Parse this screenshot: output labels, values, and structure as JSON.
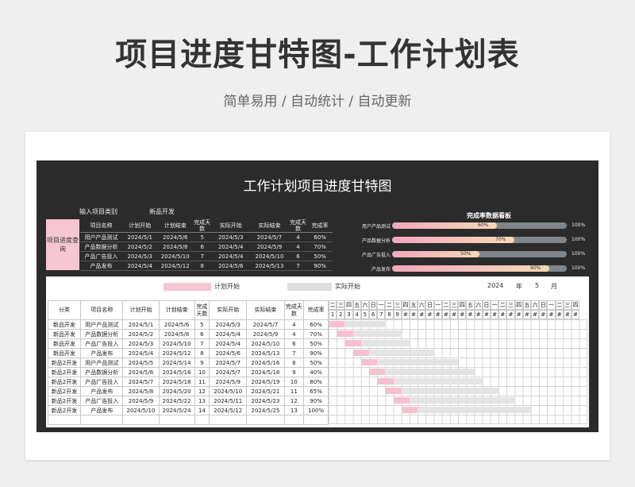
{
  "page": {
    "title": "项目进度甘特图-工作计划表",
    "subtitle": "简单易用  /  自动统计  /  自动更新"
  },
  "dashboard": {
    "title": "工作计划项目进度甘特图",
    "category_label": "输入项目类别",
    "category_value": "新品开发",
    "query_label": "项目进度查询"
  },
  "top_table": {
    "headers": [
      "项目名称",
      "计划开始",
      "计划结束",
      "完成天数",
      "实际开始",
      "实际结束",
      "完成天数",
      "完成率"
    ],
    "rows": [
      [
        "用户产品测试",
        "2024/5/1",
        "2024/5/6",
        "5",
        "2024/5/3",
        "2024/5/7",
        "4",
        "60%"
      ],
      [
        "产品数据分析",
        "2024/5/2",
        "2024/5/8",
        "6",
        "2024/5/4",
        "2024/5/9",
        "4",
        "70%"
      ],
      [
        "产品广告投入",
        "2024/5/3",
        "2024/5/10",
        "7",
        "2024/5/4",
        "2024/5/10",
        "6",
        "50%"
      ],
      [
        "产品发布",
        "2024/5/4",
        "2024/5/12",
        "8",
        "2024/5/6",
        "2024/5/13",
        "7",
        "90%"
      ]
    ]
  },
  "kanban": {
    "title": "完成率数据看板",
    "max_label": "100%",
    "items": [
      {
        "label": "用户产品测试",
        "pct": "60%",
        "value": 0.6
      },
      {
        "label": "产品数据分析",
        "pct": "70%",
        "value": 0.7
      },
      {
        "label": "产品广告投入",
        "pct": "50%",
        "value": 0.5
      },
      {
        "label": "产品发布",
        "pct": "90%",
        "value": 0.9
      }
    ]
  },
  "legend": {
    "plan": "计划开始",
    "actual": "实际开始",
    "year": "2024",
    "year_unit": "年",
    "month": "5",
    "month_unit": "月"
  },
  "bottom_table": {
    "headers": [
      "分类",
      "项目名称",
      "计划开始",
      "计划结束",
      "完成天数",
      "实际开始",
      "实际结束",
      "完成天数",
      "完成率"
    ],
    "rows": [
      [
        "新品开发",
        "用户产品测试",
        "2024/5/1",
        "2024/5/6",
        "5",
        "2024/5/3",
        "2024/5/7",
        "4",
        "60%"
      ],
      [
        "新品开发",
        "产品数据分析",
        "2024/5/2",
        "2024/5/8",
        "6",
        "2024/5/4",
        "2024/5/9",
        "4",
        "70%"
      ],
      [
        "新品开发",
        "产品广告投入",
        "2024/5/3",
        "2024/5/10",
        "7",
        "2024/5/4",
        "2024/5/10",
        "6",
        "50%"
      ],
      [
        "新品开发",
        "产品发布",
        "2024/5/4",
        "2024/5/12",
        "8",
        "2024/5/6",
        "2024/5/13",
        "7",
        "90%"
      ],
      [
        "新品2开发",
        "用户产品测试",
        "2024/5/5",
        "2024/5/14",
        "9",
        "2024/5/7",
        "2024/5/16",
        "8",
        "50%"
      ],
      [
        "新品2开发",
        "产品数据分析",
        "2024/5/6",
        "2024/5/16",
        "10",
        "2024/5/7",
        "2024/5/18",
        "9",
        "40%"
      ],
      [
        "新品2开发",
        "产品广告投入",
        "2024/5/7",
        "2024/5/18",
        "11",
        "2024/5/9",
        "2024/5/19",
        "10",
        "80%"
      ],
      [
        "新品2开发",
        "产品发布",
        "2024/5/8",
        "2024/5/20",
        "12",
        "2024/5/10",
        "2024/5/21",
        "11",
        "65%"
      ],
      [
        "新品2开发",
        "产品广告投入",
        "2024/5/9",
        "2024/5/22",
        "13",
        "2024/5/11",
        "2024/5/23",
        "12",
        "90%"
      ],
      [
        "新品2开发",
        "产品发布",
        "2024/5/10",
        "2024/5/24",
        "14",
        "2024/5/12",
        "2024/5/25",
        "13",
        "100%"
      ]
    ]
  },
  "gantt": {
    "weekdays": [
      "二",
      "三",
      "四",
      "五",
      "六",
      "日",
      "一",
      "二",
      "三",
      "四",
      "五",
      "六",
      "日",
      "一",
      "二",
      "三",
      "四",
      "五",
      "六",
      "日",
      "一",
      "二",
      "三",
      "四",
      "五",
      "六",
      "日",
      "一",
      "二",
      "三",
      "四"
    ],
    "days": [
      "1",
      "2",
      "3",
      "4",
      "5",
      "6",
      "7",
      "8",
      "9",
      "#",
      "#",
      "#",
      "#",
      "#",
      "#",
      "#",
      "#",
      "#",
      "#",
      "#",
      "#",
      "#",
      "#",
      "#",
      "#",
      "#",
      "#",
      "#",
      "#",
      "#",
      "#"
    ]
  },
  "colors": {
    "frame": "#2b2b2b",
    "plan_bar": "#f6c0cf",
    "actual_bar": "#e4e4e4",
    "query_box": "#f6c6d3"
  }
}
